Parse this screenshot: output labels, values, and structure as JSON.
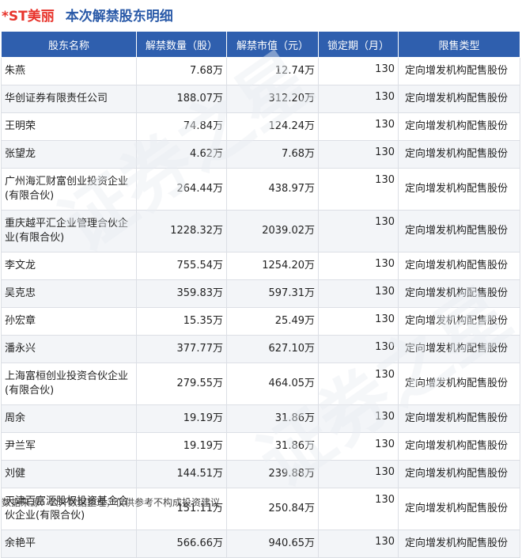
{
  "header": {
    "stock": "*ST美丽",
    "title": "本次解禁股东明细"
  },
  "table": {
    "columns": [
      "股东名称",
      "解禁数量（股）",
      "解禁市值（元）",
      "锁定期（月）",
      "限售类型"
    ],
    "rows": [
      {
        "name": "朱燕",
        "qty": "7.68万",
        "value": "12.74万",
        "lock": "130",
        "type": "定向增发机构配售股份"
      },
      {
        "name": "华创证券有限责任公司",
        "qty": "188.07万",
        "value": "312.20万",
        "lock": "130",
        "type": "定向增发机构配售股份"
      },
      {
        "name": "王明荣",
        "qty": "74.84万",
        "value": "124.24万",
        "lock": "130",
        "type": "定向增发机构配售股份"
      },
      {
        "name": "张望龙",
        "qty": "4.62万",
        "value": "7.68万",
        "lock": "130",
        "type": "定向增发机构配售股份"
      },
      {
        "name": "广州海汇财富创业投资企业(有限合伙)",
        "qty": "264.44万",
        "value": "438.97万",
        "lock": "130",
        "type": "定向增发机构配售股份"
      },
      {
        "name": "重庆越平汇企业管理合伙企业(有限合伙)",
        "qty": "1228.32万",
        "value": "2039.02万",
        "lock": "130",
        "type": "定向增发机构配售股份"
      },
      {
        "name": "李文龙",
        "qty": "755.54万",
        "value": "1254.20万",
        "lock": "130",
        "type": "定向增发机构配售股份"
      },
      {
        "name": "吴克忠",
        "qty": "359.83万",
        "value": "597.31万",
        "lock": "130",
        "type": "定向增发机构配售股份"
      },
      {
        "name": "孙宏章",
        "qty": "15.35万",
        "value": "25.49万",
        "lock": "130",
        "type": "定向增发机构配售股份"
      },
      {
        "name": "潘永兴",
        "qty": "377.77万",
        "value": "627.10万",
        "lock": "130",
        "type": "定向增发机构配售股份"
      },
      {
        "name": "上海富桓创业投资合伙企业(有限合伙)",
        "qty": "279.55万",
        "value": "464.05万",
        "lock": "130",
        "type": "定向增发机构配售股份"
      },
      {
        "name": "周余",
        "qty": "19.19万",
        "value": "31.86万",
        "lock": "130",
        "type": "定向增发机构配售股份"
      },
      {
        "name": "尹兰军",
        "qty": "19.19万",
        "value": "31.86万",
        "lock": "130",
        "type": "定向增发机构配售股份"
      },
      {
        "name": "刘健",
        "qty": "144.51万",
        "value": "239.88万",
        "lock": "130",
        "type": "定向增发机构配售股份"
      },
      {
        "name": "天津百富源股权投资基金合伙企业(有限合伙)",
        "qty": "151.11万",
        "value": "250.84万",
        "lock": "130",
        "type": "定向增发机构配售股份"
      },
      {
        "name": "余艳平",
        "qty": "566.66万",
        "value": "940.65万",
        "lock": "130",
        "type": "定向增发机构配售股份"
      }
    ]
  },
  "footer": {
    "source": "数据来源：公开数据整理，仅供参考不构成投资建议"
  },
  "colors": {
    "header_bg": "#2f5fae",
    "stock_title": "#e8342c",
    "main_title": "#2a5aa8",
    "stripe": "#f3f5f8"
  }
}
